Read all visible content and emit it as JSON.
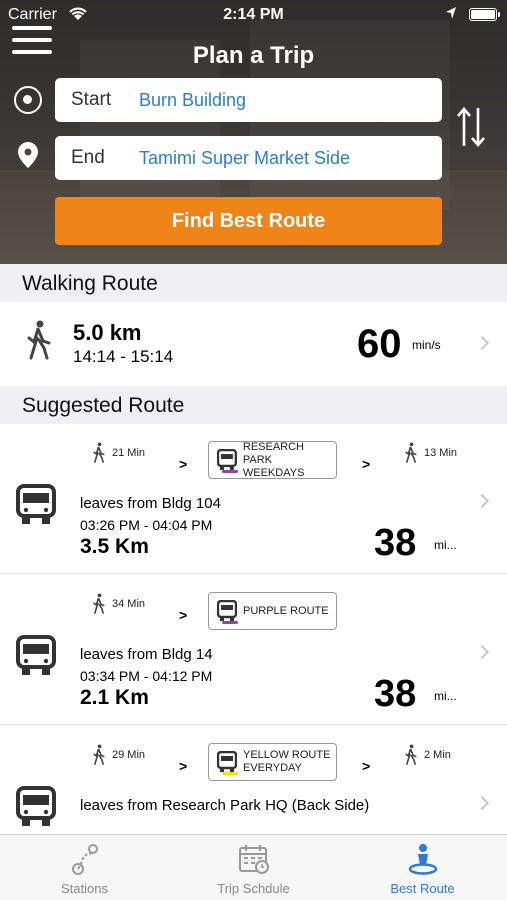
{
  "status": {
    "carrier": "Carrier",
    "time": "2:14 PM"
  },
  "header": {
    "title": "Plan a Trip"
  },
  "form": {
    "start_label": "Start",
    "start_value": "Burn Building",
    "end_label": "End",
    "end_value": "Tamimi Super Market Side",
    "find_button": "Find Best Route"
  },
  "walking": {
    "heading": "Walking Route",
    "distance": "5.0 km",
    "times": "14:14 - 15:14",
    "minutes": "60",
    "unit": "min/s"
  },
  "suggested": {
    "heading": "Suggested Route",
    "routes": [
      {
        "walk1": "21 Min",
        "bus_line1": "RESEARCH",
        "bus_line2": "PARK WEEKDAYS",
        "stripe": "#8e44ad",
        "walk2": "13 Min",
        "leaves": "leaves from Bldg 104",
        "times": "03:26 PM - 04:04 PM",
        "distance": "3.5 Km",
        "minutes": "38",
        "unit": "mi..."
      },
      {
        "walk1": "34 Min",
        "bus_line1": "PURPLE ROUTE",
        "bus_line2": "",
        "stripe": "#8e44ad",
        "walk2": "",
        "leaves": "leaves from Bldg 14",
        "times": "03:34 PM - 04:12 PM",
        "distance": "2.1 Km",
        "minutes": "38",
        "unit": "mi..."
      },
      {
        "walk1": "29 Min",
        "bus_line1": "YELLOW ROUTE",
        "bus_line2": "EVERYDAY",
        "stripe": "#f1e40f",
        "walk2": "2 Min",
        "leaves": "leaves from Research Park HQ (Back Side)",
        "times": "",
        "distance": "",
        "minutes": "",
        "unit": ""
      }
    ]
  },
  "tabs": [
    {
      "label": "Stations",
      "icon": "stations-icon"
    },
    {
      "label": "Trip Schdule",
      "icon": "calendar-icon"
    },
    {
      "label": "Best Route",
      "icon": "best-route-icon"
    }
  ],
  "colors": {
    "accent": "#ef8419",
    "link": "#2d7bd6"
  }
}
